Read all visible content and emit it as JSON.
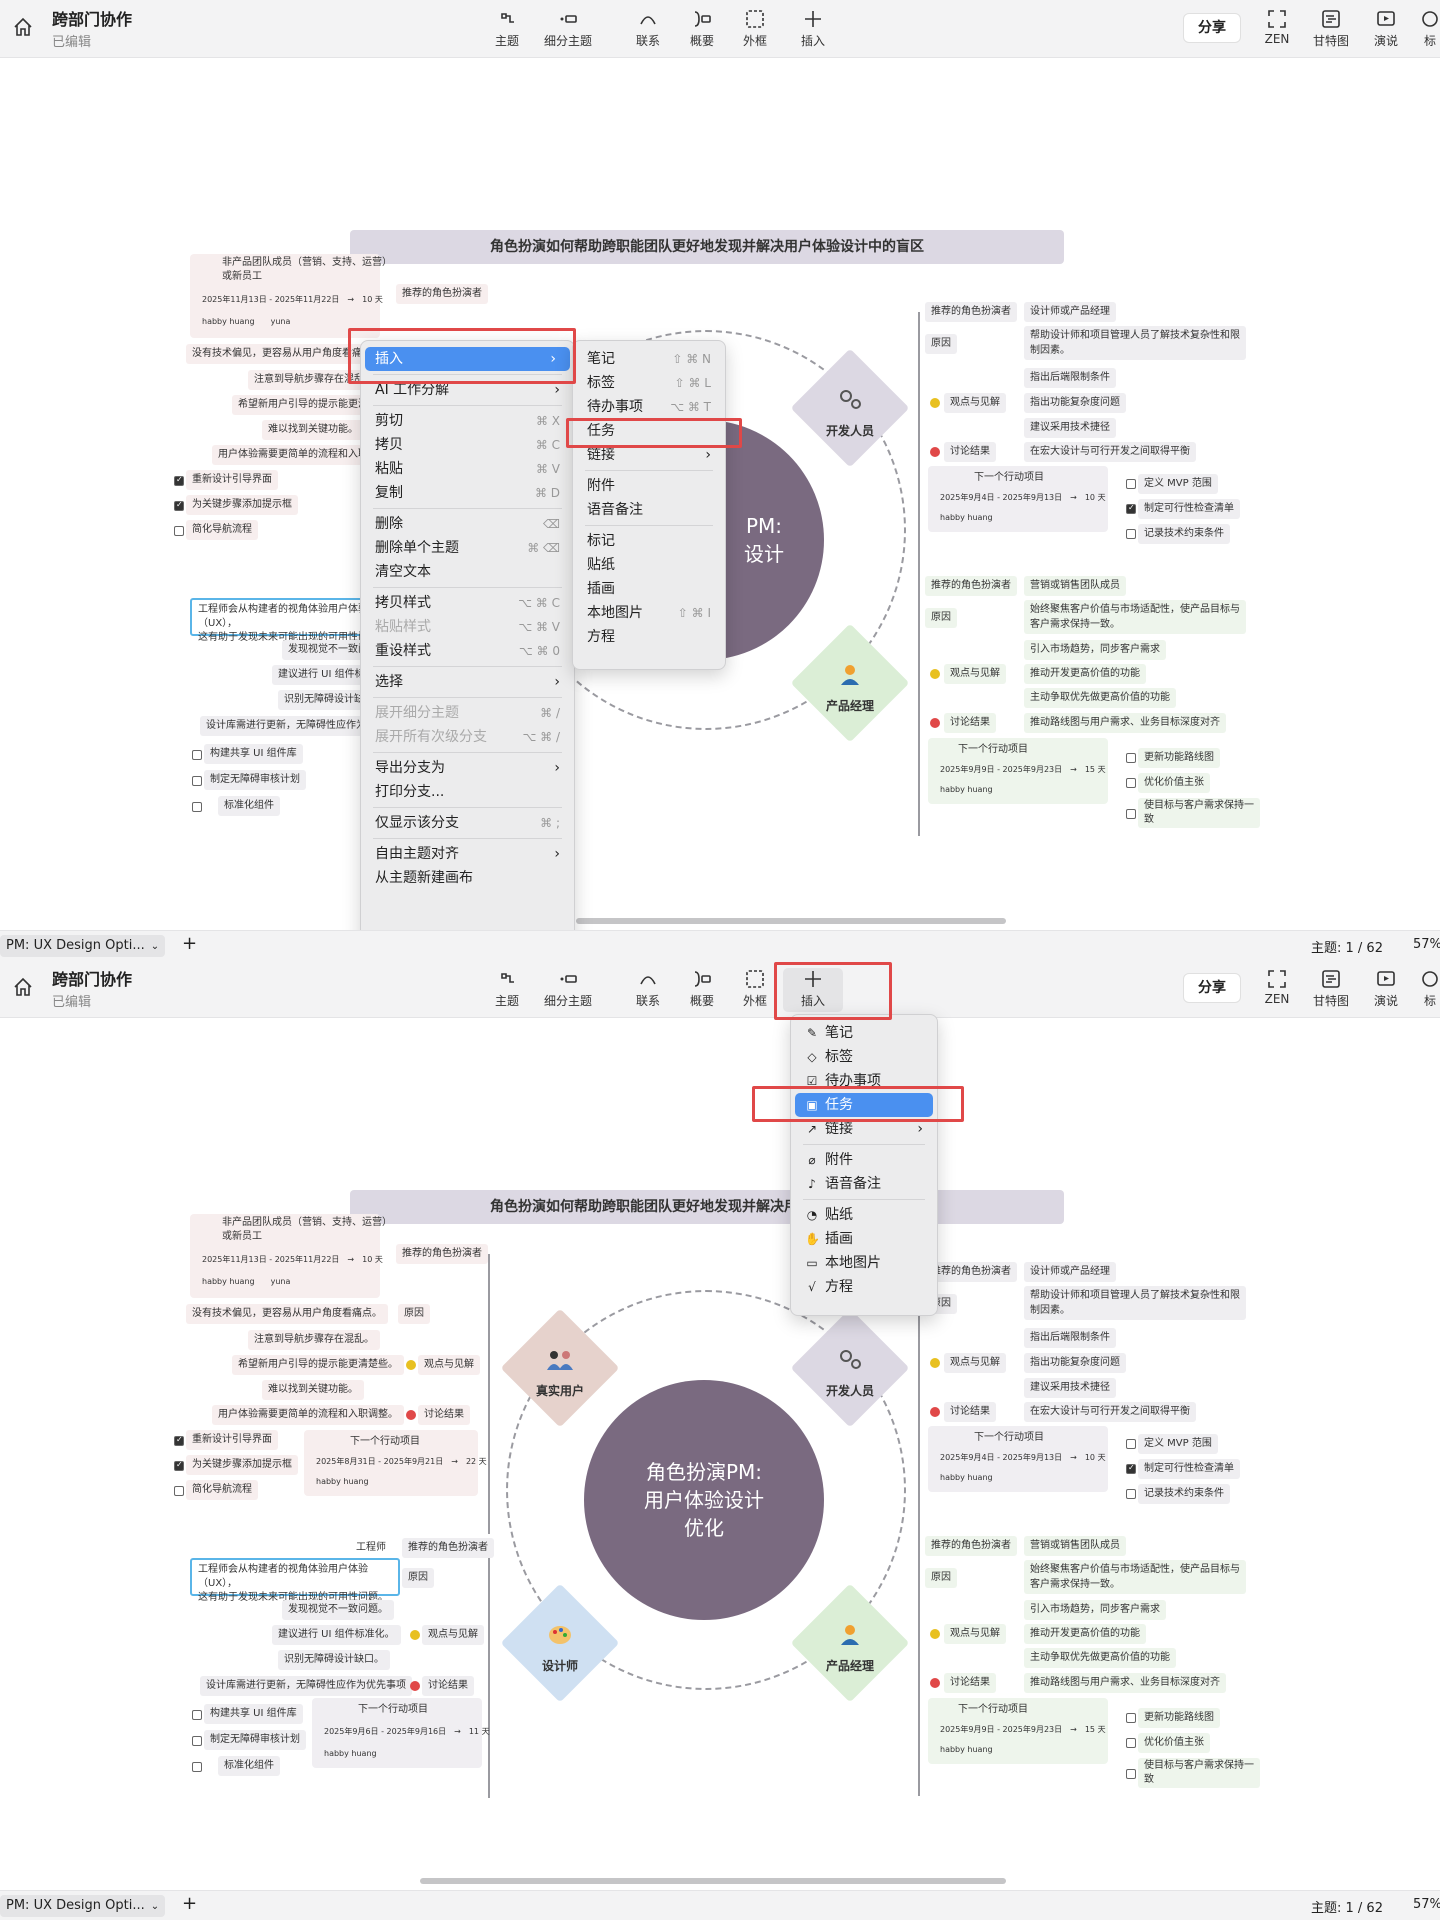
{
  "app": {
    "doc_title": "跨部门协作",
    "doc_status": "已编辑"
  },
  "toolbar": {
    "topic": "主题",
    "subtopic": "细分主题",
    "relation": "联系",
    "summary": "概要",
    "boundary": "外框",
    "insert": "插入",
    "share": "分享",
    "zen": "ZEN",
    "gantt": "甘特图",
    "present": "演说",
    "more": "标"
  },
  "bottombar": {
    "sheet_tab": "PM: UX Design Opti...",
    "topic_count": "主题: 1 / 62",
    "zoom": "57%"
  },
  "map": {
    "title": "角色扮演如何帮助跨职能团队更好地发现并解决用户体验设计中的盲区",
    "center": [
      "角色扮演PM:",
      "用户体验设计",
      "优化"
    ],
    "center_partial": [
      "PM:",
      "设计"
    ],
    "branches": {
      "dev": "开发人员",
      "pm": "产品经理",
      "user": "真实用户",
      "designer": "设计师"
    },
    "right_top": {
      "role": "推荐的角色扮演者",
      "role_val": "设计师或产品经理",
      "reason": "原因",
      "reason_val1": "帮助设计师和项目管理人员了解技术复杂性和限",
      "reason_val2": "制因素。",
      "insight": "观点与见解",
      "ins1": "指出后端限制条件",
      "ins2": "指出功能复杂度问题",
      "ins3": "建议采用技术捷径",
      "discuss": "讨论结果",
      "discuss_val": "在宏大设计与可行开发之间取得平衡",
      "next": "下一个行动项目",
      "date": "2025年9月4日 - 2025年9月13日",
      "days": "10 天",
      "person": "habby huang",
      "t1": "定义 MVP 范围",
      "t2": "制定可行性检查清单",
      "t3": "记录技术约束条件"
    },
    "right_bottom": {
      "role": "推荐的角色扮演者",
      "role_val": "营销或销售团队成员",
      "reason": "原因",
      "reason_val1": "始终聚焦客户价值与市场适配性，使产品目标与",
      "reason_val2": "客户需求保持一致。",
      "insight": "观点与见解",
      "ins1": "引入市场趋势，同步客户需求",
      "ins2": "推动开发更高价值的功能",
      "ins3": "主动争取优先做更高价值的功能",
      "discuss": "讨论结果",
      "discuss_val": "推动路线图与用户需求、业务目标深度对齐",
      "next": "下一个行动项目",
      "date": "2025年9月9日 - 2025年9月23日",
      "days": "15 天",
      "person": "habby huang",
      "t1": "更新功能路线图",
      "t2": "优化价值主张",
      "t3a": "使目标与客户需求保持一",
      "t3b": "致"
    },
    "left_top": {
      "card_text1": "非产品团队成员（营销、支持、运营）",
      "card_text2": "或新员工",
      "card_date": "2025年11月13日 - 2025年11月22日",
      "card_days": "10 天",
      "card_person1": "habby huang",
      "card_person2": "yuna",
      "role": "推荐的角色扮演者",
      "reason_val": "没有技术偏见，更容易从用户角度看痛点。",
      "reason": "原因",
      "ins1": "注意到导航步骤存在混乱。",
      "ins2": "希望新用户引导的提示能更清楚些。",
      "ins3": "难以找到关键功能。",
      "insight": "观点与见解",
      "discuss_val": "用户体验需要更简单的流程和入职调整。",
      "discuss": "讨论结果",
      "t1": "重新设计引导界面",
      "t2": "为关键步骤添加提示框",
      "t3": "简化导航流程",
      "next": "下一个行动项目",
      "date": "2025年8月31日 - 2025年9月21日",
      "days": "22 天",
      "person": "habby huang"
    },
    "left_bottom": {
      "role_val": "工程师",
      "role": "推荐的角色扮演者",
      "reason_val1": "工程师会从构建者的视角体验用户体验（UX），",
      "reason_val2": "这有助于发现未来可能出现的可用性问题。",
      "reason": "原因",
      "ins1": "发现视觉不一致问题。",
      "ins2": "建议进行 UI 组件标准化。",
      "ins3": "识别无障碍设计缺口。",
      "insight": "观点与见解",
      "discuss_val": "设计库需进行更新，无障碍性应作为优先事项",
      "discuss": "讨论结果",
      "t1": "构建共享 UI 组件库",
      "t2": "制定无障碍审核计划",
      "t3": "标准化组件",
      "next": "下一个行动项目",
      "date": "2025年9月6日 - 2025年9月16日",
      "days": "11 天",
      "person": "habby huang"
    }
  },
  "context_menu": {
    "insert": "插入",
    "ai": "AI 工作分解",
    "cut": "剪切",
    "cut_sc": "⌘ X",
    "copy": "拷贝",
    "copy_sc": "⌘ C",
    "paste": "粘贴",
    "paste_sc": "⌘ V",
    "duplicate": "复制",
    "duplicate_sc": "⌘ D",
    "delete": "删除",
    "delete_sc": "⌫",
    "delete_single": "删除单个主题",
    "delete_single_sc": "⌘ ⌫",
    "clear_text": "清空文本",
    "copy_style": "拷贝样式",
    "copy_style_sc": "⌥ ⌘ C",
    "paste_style": "粘贴样式",
    "paste_style_sc": "⌥ ⌘ V",
    "reset_style": "重设样式",
    "reset_style_sc": "⌥ ⌘ 0",
    "select": "选择",
    "expand_sub": "展开细分主题",
    "expand_sub_sc": "⌘ /",
    "expand_all": "展开所有次级分支",
    "expand_all_sc": "⌥ ⌘ /",
    "export_branch": "导出分支为",
    "print_branch": "打印分支...",
    "only_branch": "仅显示该分支",
    "only_branch_sc": "⌘ ;",
    "free_align": "自由主题对齐",
    "new_canvas": "从主题新建画布"
  },
  "insert_submenu": {
    "note": "笔记",
    "note_sc": "⇧ ⌘ N",
    "label": "标签",
    "label_sc": "⇧ ⌘ L",
    "todo": "待办事项",
    "todo_sc": "⌥ ⌘ T",
    "task": "任务",
    "link": "链接",
    "attachment": "附件",
    "audio": "语音备注",
    "marker": "标记",
    "sticker": "贴纸",
    "illustration": "插画",
    "local_image": "本地图片",
    "local_image_sc": "⇧ ⌘ I",
    "equation": "方程"
  },
  "insert_dropdown": {
    "note": "笔记",
    "label": "标签",
    "todo": "待办事项",
    "task": "任务",
    "link": "链接",
    "attachment": "附件",
    "audio": "语音备注",
    "sticker": "贴纸",
    "illustration": "插画",
    "local_image": "本地图片",
    "equation": "方程"
  },
  "colors": {
    "accent": "#4a90f0",
    "highlight": "#e04848",
    "center": "#7a6a80"
  }
}
